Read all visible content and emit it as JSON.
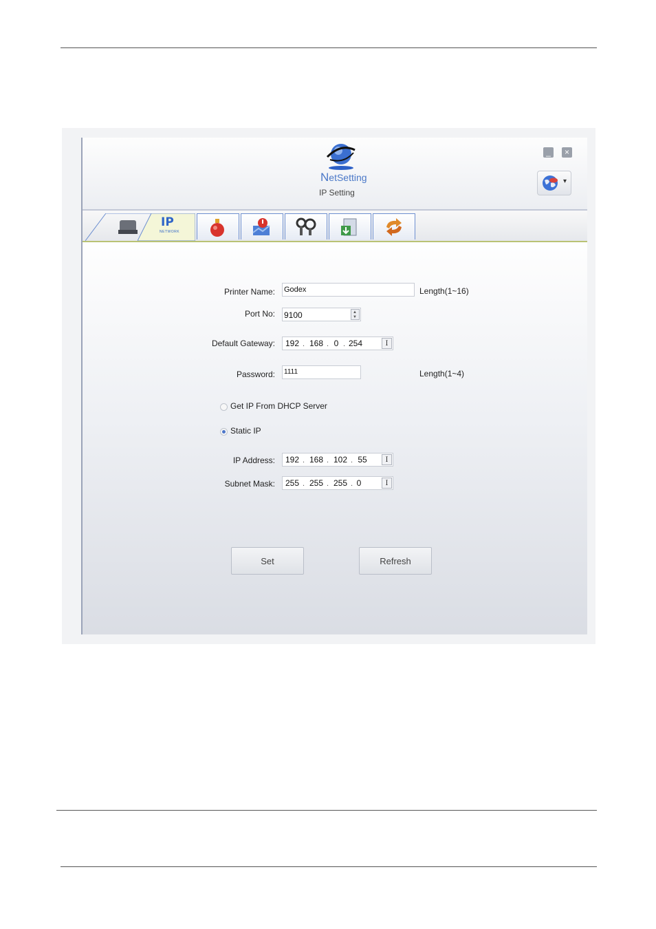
{
  "app": {
    "logo_text_n": "N",
    "logo_text_rest": "etSetting",
    "subtitle": "IP Setting",
    "minimize_symbol": "_",
    "close_symbol": "×",
    "language_icon": "globe-icon",
    "language_caret": "▾"
  },
  "tabs": [
    {
      "name": "printer",
      "icon": "printer-icon"
    },
    {
      "name": "ip-network",
      "label": "IP",
      "sublabel": "NETWORK"
    },
    {
      "name": "alert",
      "icon": "bell-alarm-icon"
    },
    {
      "name": "warning",
      "icon": "warning-chart-icon"
    },
    {
      "name": "tools",
      "icon": "tools-icon"
    },
    {
      "name": "download",
      "icon": "file-download-icon"
    },
    {
      "name": "sync",
      "icon": "sync-arrows-icon"
    }
  ],
  "form": {
    "printer_name": {
      "label": "Printer Name:",
      "value": "Godex",
      "hint": "Length(1~16)"
    },
    "port_no": {
      "label": "Port No:",
      "value": "9100"
    },
    "default_gateway": {
      "label": "Default Gateway:",
      "octets": [
        "192",
        "168",
        "0",
        "254"
      ]
    },
    "password": {
      "label": "Password:",
      "value": "1111",
      "hint": "Length(1~4)"
    },
    "dhcp": {
      "label": "Get IP From DHCP Server",
      "selected": false
    },
    "static_ip": {
      "label": "Static IP",
      "selected": true
    },
    "ip_address": {
      "label": "IP Address:",
      "octets": [
        "192",
        "168",
        "102",
        "55"
      ]
    },
    "subnet_mask": {
      "label": "Subnet Mask:",
      "octets": [
        "255",
        "255",
        "255",
        "0"
      ]
    },
    "ibeam_symbol": "I"
  },
  "buttons": {
    "set": "Set",
    "refresh": "Refresh"
  },
  "colors": {
    "accent": "#4a78c8",
    "tab_border": "#6d8fd0",
    "tab_underline": "#b9c274"
  }
}
